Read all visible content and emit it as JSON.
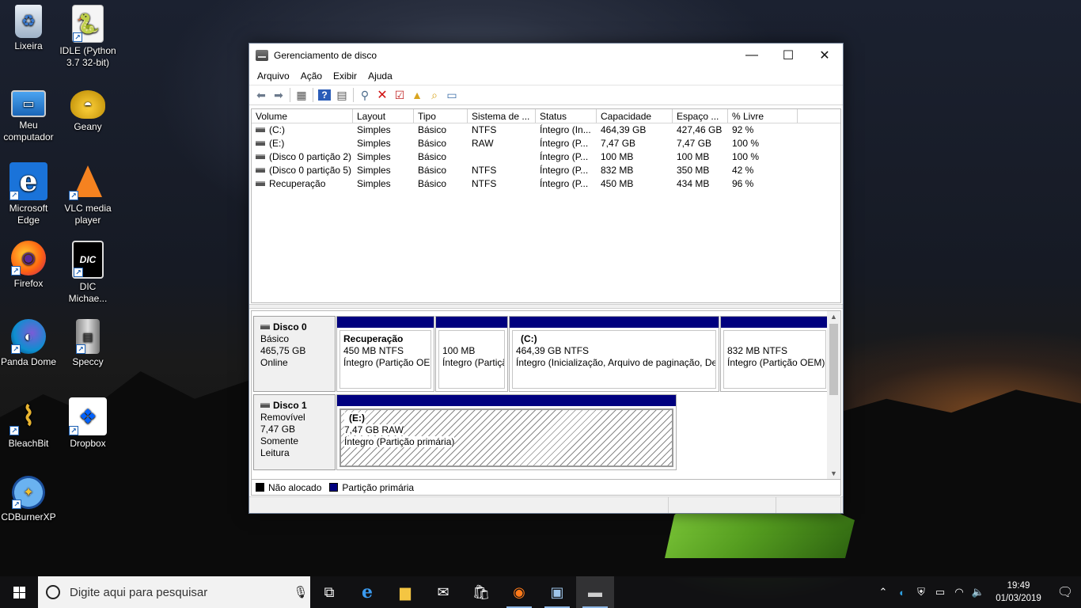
{
  "desktop": {
    "icons": [
      {
        "label": "Lixeira",
        "icon": "recycle-bin-icon"
      },
      {
        "label": "IDLE (Python 3.7 32-bit)",
        "icon": "python-icon"
      },
      {
        "label": "Meu computador",
        "icon": "computer-icon"
      },
      {
        "label": "Geany",
        "icon": "geany-lamp-icon"
      },
      {
        "label": "Microsoft Edge",
        "icon": "edge-icon"
      },
      {
        "label": "VLC media player",
        "icon": "vlc-cone-icon"
      },
      {
        "label": "Firefox",
        "icon": "firefox-icon"
      },
      {
        "label": "DIC Michae...",
        "icon": "dic-icon"
      },
      {
        "label": "Panda Dome",
        "icon": "panda-dome-icon"
      },
      {
        "label": "Speccy",
        "icon": "speccy-icon"
      },
      {
        "label": "BleachBit",
        "icon": "bleachbit-broom-icon"
      },
      {
        "label": "Dropbox",
        "icon": "dropbox-icon"
      },
      {
        "label": "CDBurnerXP",
        "icon": "cdburnerxp-disc-icon"
      }
    ]
  },
  "window": {
    "title": "Gerenciamento de disco",
    "controls": {
      "minimize": "—",
      "maximize": "☐",
      "close": "✕"
    },
    "menu": [
      "Arquivo",
      "Ação",
      "Exibir",
      "Ajuda"
    ],
    "toolbar_icons": [
      "back-arrow-icon",
      "forward-arrow-icon",
      "disk-list-icon",
      "help-icon",
      "properties-icon",
      "connect-icon",
      "delete-icon",
      "check-icon",
      "folder-up-icon",
      "search-folder-icon",
      "view-icon"
    ]
  },
  "volume_list": {
    "columns": [
      "Volume",
      "Layout",
      "Tipo",
      "Sistema de ...",
      "Status",
      "Capacidade",
      "Espaço ...",
      "% Livre"
    ],
    "rows": [
      [
        "(C:)",
        "Simples",
        "Básico",
        "NTFS",
        "Íntegro (In...",
        "464,39 GB",
        "427,46 GB",
        "92 %"
      ],
      [
        "(E:)",
        "Simples",
        "Básico",
        "RAW",
        "Íntegro (P...",
        "7,47 GB",
        "7,47 GB",
        "100 %"
      ],
      [
        "(Disco 0 partição 2)",
        "Simples",
        "Básico",
        "",
        "Íntegro (P...",
        "100 MB",
        "100 MB",
        "100 %"
      ],
      [
        "(Disco 0 partição 5)",
        "Simples",
        "Básico",
        "NTFS",
        "Íntegro (P...",
        "832 MB",
        "350 MB",
        "42 %"
      ],
      [
        "Recuperação",
        "Simples",
        "Básico",
        "NTFS",
        "Íntegro (P...",
        "450 MB",
        "434 MB",
        "96 %"
      ]
    ]
  },
  "disks": [
    {
      "name": "Disco 0",
      "type": "Básico",
      "size": "465,75 GB",
      "state": "Online",
      "partitions": [
        {
          "name": "Recuperação",
          "size": "450 MB NTFS",
          "status": "Íntegro (Partição OEI"
        },
        {
          "name": "",
          "size": "100 MB",
          "status": "Íntegro (Partiçã"
        },
        {
          "name": "(C:)",
          "size": "464,39 GB NTFS",
          "status": "Íntegro (Inicialização, Arquivo de paginação, De"
        },
        {
          "name": "",
          "size": "832 MB NTFS",
          "status": "Íntegro (Partição OEM)"
        }
      ]
    },
    {
      "name": "Disco 1",
      "type": "Removível",
      "size": "7,47 GB",
      "state": "Somente Leitura",
      "partitions": [
        {
          "name": "(E:)",
          "size": "7,47 GB RAW",
          "status": "Íntegro (Partição primária)"
        }
      ]
    }
  ],
  "legend": [
    {
      "label": "Não alocado",
      "color": "#000000"
    },
    {
      "label": "Partição primária",
      "color": "#00007f"
    }
  ],
  "taskbar": {
    "search_placeholder": "Digite aqui para pesquisar",
    "apps": [
      "task-view-icon",
      "edge-icon",
      "file-explorer-icon",
      "mail-icon",
      "store-icon",
      "firefox-icon",
      "network-pc-icon",
      "disk-management-icon"
    ],
    "time": "19:49",
    "date": "01/03/2019"
  }
}
